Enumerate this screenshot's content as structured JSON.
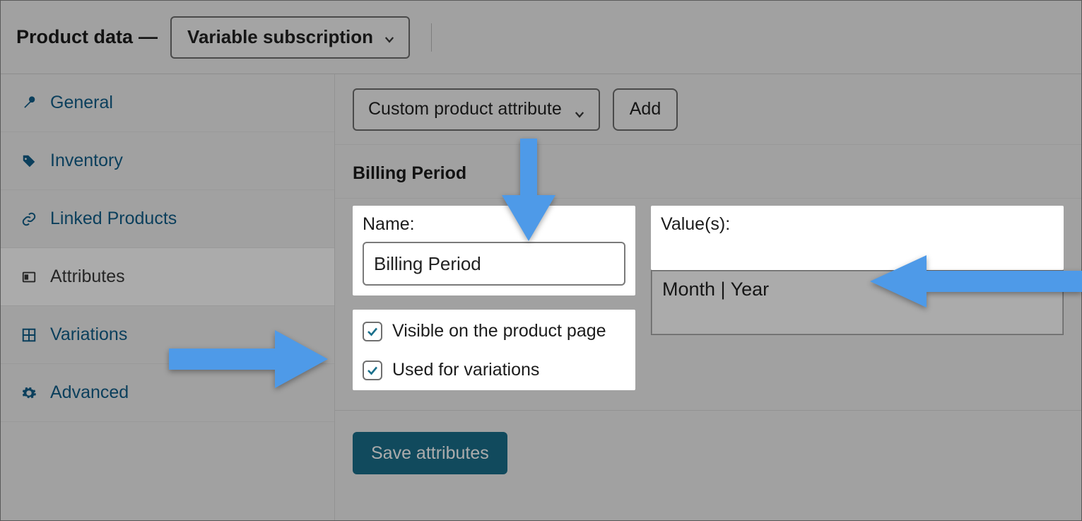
{
  "header": {
    "title": "Product data",
    "dash": "—",
    "product_type": "Variable subscription"
  },
  "sidebar": {
    "items": [
      {
        "label": "General"
      },
      {
        "label": "Inventory"
      },
      {
        "label": "Linked Products"
      },
      {
        "label": "Attributes"
      },
      {
        "label": "Variations"
      },
      {
        "label": "Advanced"
      }
    ]
  },
  "toolbar": {
    "attribute_selector": "Custom product attribute",
    "add_label": "Add"
  },
  "attribute": {
    "header_title": "Billing Period",
    "name_label": "Name:",
    "name_value": "Billing Period",
    "values_label": "Value(s):",
    "values_value": "Month | Year",
    "visible_label": "Visible on the product page",
    "used_for_variations_label": "Used for variations",
    "visible_checked": true,
    "used_for_variations_checked": true
  },
  "footer": {
    "save_label": "Save attributes"
  }
}
